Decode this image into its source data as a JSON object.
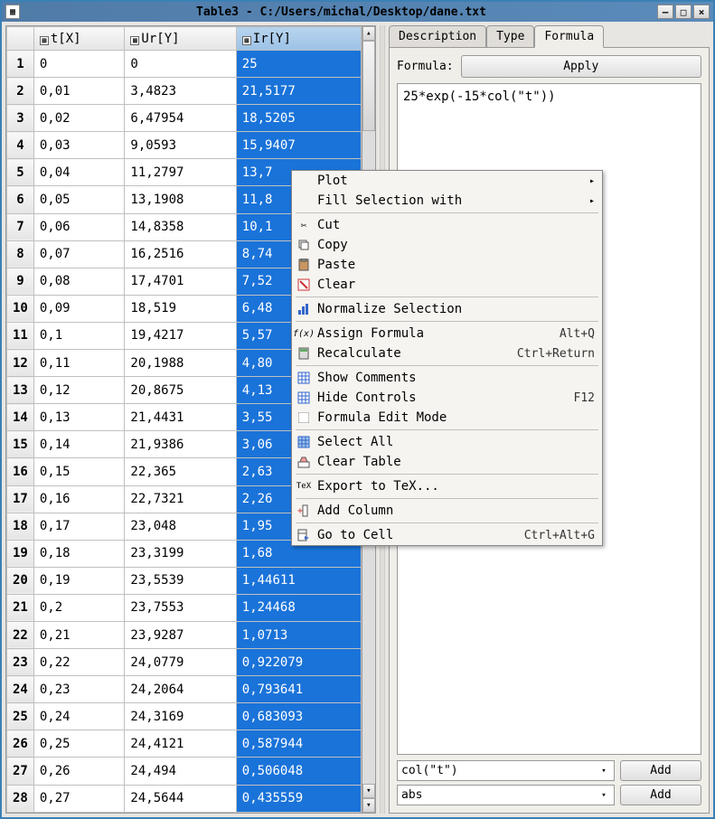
{
  "window": {
    "title": "Table3 - C:/Users/michal/Desktop/dane.txt"
  },
  "columns": {
    "c0": "t[X]",
    "c1": "Ur[Y]",
    "c2": "Ir[Y]"
  },
  "rows": [
    {
      "n": "1",
      "t": "0",
      "ur": "0",
      "ir": "25"
    },
    {
      "n": "2",
      "t": "0,01",
      "ur": "3,4823",
      "ir": "21,5177"
    },
    {
      "n": "3",
      "t": "0,02",
      "ur": "6,47954",
      "ir": "18,5205"
    },
    {
      "n": "4",
      "t": "0,03",
      "ur": "9,0593",
      "ir": "15,9407"
    },
    {
      "n": "5",
      "t": "0,04",
      "ur": "11,2797",
      "ir": "13,7"
    },
    {
      "n": "6",
      "t": "0,05",
      "ur": "13,1908",
      "ir": "11,8"
    },
    {
      "n": "7",
      "t": "0,06",
      "ur": "14,8358",
      "ir": "10,1"
    },
    {
      "n": "8",
      "t": "0,07",
      "ur": "16,2516",
      "ir": "8,74"
    },
    {
      "n": "9",
      "t": "0,08",
      "ur": "17,4701",
      "ir": "7,52"
    },
    {
      "n": "10",
      "t": "0,09",
      "ur": "18,519",
      "ir": "6,48"
    },
    {
      "n": "11",
      "t": "0,1",
      "ur": "19,4217",
      "ir": "5,57"
    },
    {
      "n": "12",
      "t": "0,11",
      "ur": "20,1988",
      "ir": "4,80"
    },
    {
      "n": "13",
      "t": "0,12",
      "ur": "20,8675",
      "ir": "4,13"
    },
    {
      "n": "14",
      "t": "0,13",
      "ur": "21,4431",
      "ir": "3,55"
    },
    {
      "n": "15",
      "t": "0,14",
      "ur": "21,9386",
      "ir": "3,06"
    },
    {
      "n": "16",
      "t": "0,15",
      "ur": "22,365",
      "ir": "2,63"
    },
    {
      "n": "17",
      "t": "0,16",
      "ur": "22,7321",
      "ir": "2,26"
    },
    {
      "n": "18",
      "t": "0,17",
      "ur": "23,048",
      "ir": "1,95"
    },
    {
      "n": "19",
      "t": "0,18",
      "ur": "23,3199",
      "ir": "1,68"
    },
    {
      "n": "20",
      "t": "0,19",
      "ur": "23,5539",
      "ir": "1,44611"
    },
    {
      "n": "21",
      "t": "0,2",
      "ur": "23,7553",
      "ir": "1,24468"
    },
    {
      "n": "22",
      "t": "0,21",
      "ur": "23,9287",
      "ir": "1,0713"
    },
    {
      "n": "23",
      "t": "0,22",
      "ur": "24,0779",
      "ir": "0,922079"
    },
    {
      "n": "24",
      "t": "0,23",
      "ur": "24,2064",
      "ir": "0,793641"
    },
    {
      "n": "25",
      "t": "0,24",
      "ur": "24,3169",
      "ir": "0,683093"
    },
    {
      "n": "26",
      "t": "0,25",
      "ur": "24,4121",
      "ir": "0,587944"
    },
    {
      "n": "27",
      "t": "0,26",
      "ur": "24,494",
      "ir": "0,506048"
    },
    {
      "n": "28",
      "t": "0,27",
      "ur": "24,5644",
      "ir": "0,435559"
    }
  ],
  "tabs": {
    "t0": "Description",
    "t1": "Type",
    "t2": "Formula"
  },
  "formula": {
    "label": "Formula:",
    "apply": "Apply",
    "text": "25*exp(-15*col(\"t\"))",
    "combo1": "col(\"t\")",
    "combo2": "abs",
    "add": "Add"
  },
  "menu": {
    "plot": "Plot",
    "fill": "Fill Selection with",
    "cut": "Cut",
    "copy": "Copy",
    "paste": "Paste",
    "clear": "Clear",
    "normalize": "Normalize Selection",
    "assign": "Assign Formula",
    "assign_sc": "Alt+Q",
    "recalc": "Recalculate",
    "recalc_sc": "Ctrl+Return",
    "showc": "Show Comments",
    "hidec": "Hide Controls",
    "hidec_sc": "F12",
    "fedit": "Formula Edit Mode",
    "selall": "Select All",
    "cleart": "Clear Table",
    "export": "Export to TeX...",
    "addcol": "Add Column",
    "goto": "Go to Cell",
    "goto_sc": "Ctrl+Alt+G"
  }
}
